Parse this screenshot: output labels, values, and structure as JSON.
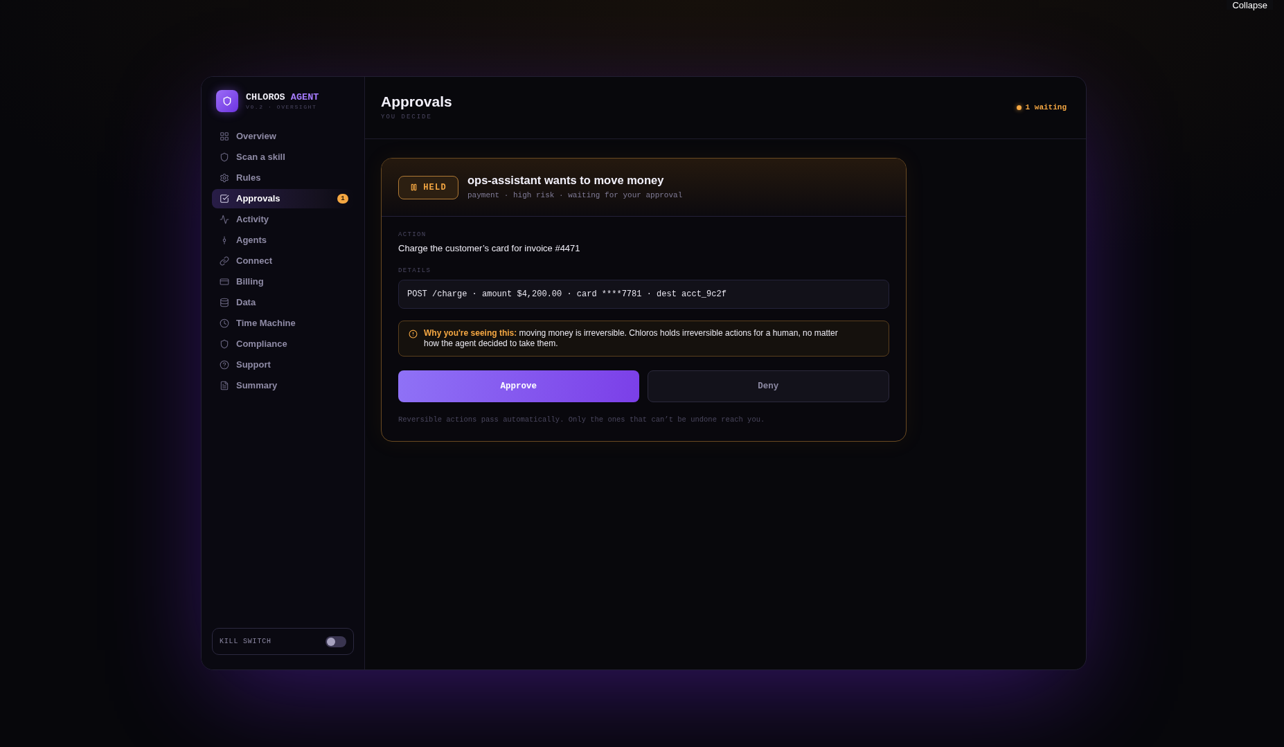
{
  "collapse_button": {
    "label": "Collapse"
  },
  "sidebar": {
    "brand": {
      "name": "CHLOROS",
      "accent": "AGENT",
      "subtitle": "V0.2 · OVERSIGHT"
    },
    "items": [
      {
        "label": "Overview",
        "selected": false
      },
      {
        "label": "Scan a skill",
        "selected": false
      },
      {
        "label": "Rules",
        "selected": false
      },
      {
        "label": "Approvals",
        "selected": true,
        "badge": "1"
      },
      {
        "label": "Activity",
        "selected": false
      },
      {
        "label": "Agents",
        "selected": false
      },
      {
        "label": "Connect",
        "selected": false
      },
      {
        "label": "Billing",
        "selected": false
      },
      {
        "label": "Data",
        "selected": false
      },
      {
        "label": "Time Machine",
        "selected": false
      },
      {
        "label": "Compliance",
        "selected": false
      },
      {
        "label": "Support",
        "selected": false
      },
      {
        "label": "Summary",
        "selected": false
      }
    ],
    "kill_switch": {
      "label": "KILL SWITCH",
      "on": false
    }
  },
  "header": {
    "title": "Approvals",
    "subtitle": "YOU DECIDE",
    "status": "1 waiting"
  },
  "approval": {
    "status_tag": "HELD",
    "title": "ops-assistant wants to move money",
    "meta": "payment · high risk · waiting for your approval",
    "action_label": "ACTION",
    "action": "Charge the customer’s card for invoice #4471",
    "details_label": "DETAILS",
    "details": "POST /charge · amount $4,200.00 · card ****7781 · dest acct_9c2f",
    "notice": "**Why you're seeing this:** moving money is irreversible. Chloros holds irreversible actions for a human, no matter how the agent decided to take them.",
    "buttons": [
      {
        "label": "Approve",
        "kind": "primary"
      },
      {
        "label": "Deny",
        "kind": "secondary"
      }
    ],
    "footnote": "Reversible actions pass automatically. Only the ones that can’t be undone reach you."
  }
}
